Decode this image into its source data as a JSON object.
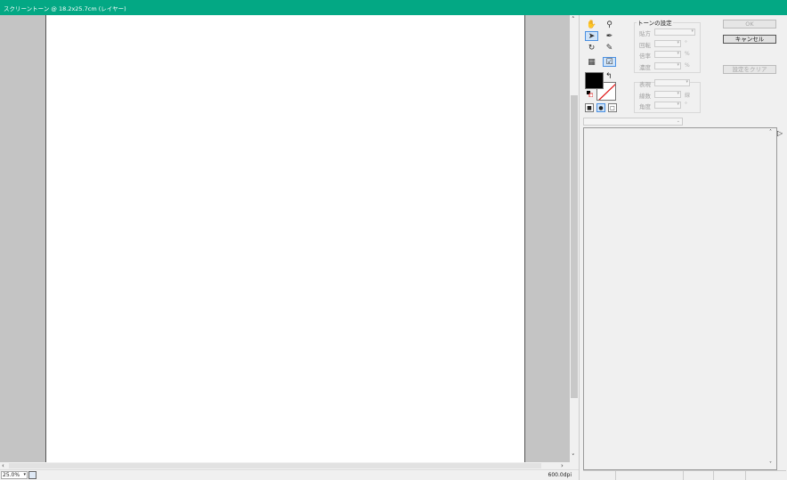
{
  "window": {
    "title": "スクリーントーン @ 18.2x25.7cm (レイヤー)"
  },
  "colors": {
    "titlebar": "#03a884",
    "canvas_bg": "#c4c4c4",
    "paper": "#ffffff",
    "selection": "#cfe3f8"
  },
  "toolbox": {
    "tools": [
      {
        "name": "hand-tool",
        "icon": "hand-icon"
      },
      {
        "name": "zoom-tool",
        "icon": "magnifier-icon"
      },
      {
        "name": "select-tool",
        "icon": "arrow-icon",
        "selected": true
      },
      {
        "name": "pen-tool",
        "icon": "pen-icon"
      },
      {
        "name": "lasso-tool",
        "icon": "lasso-icon"
      },
      {
        "name": "eraser-tool",
        "icon": "eraser-icon"
      },
      {
        "name": "tone-tool-a",
        "icon": "tone-a-icon"
      },
      {
        "name": "tone-tool-b",
        "icon": "tone-b-icon",
        "selected": true
      }
    ]
  },
  "tone_settings": {
    "title": "トーンの設定",
    "paste_label": "貼方",
    "rotation_label": "回転",
    "rotation_unit": "°",
    "scale_label": "倍率",
    "scale_unit": "%",
    "density_label": "濃度",
    "density_unit": "%"
  },
  "pattern_settings": {
    "expression_label": "表現",
    "lines_label": "線数",
    "lines_unit": "線",
    "angle_label": "角度",
    "angle_unit": "°"
  },
  "buttons": {
    "ok": "OK",
    "cancel": "キャンセル",
    "clear": "設定をクリア"
  },
  "status": {
    "zoom": "25.0%",
    "resolution": "600.0dpi"
  }
}
